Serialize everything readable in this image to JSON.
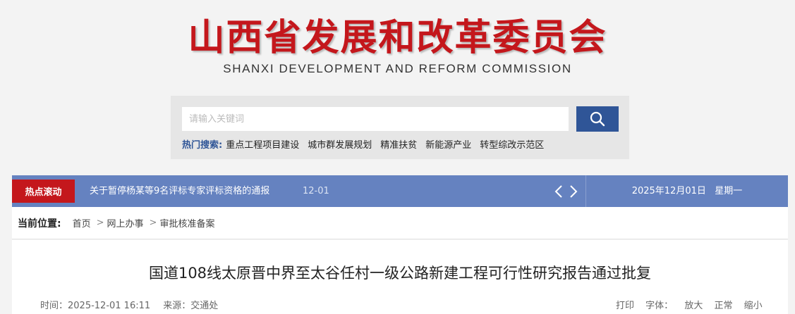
{
  "header": {
    "title": "山西省发展和改革委员会",
    "subtitle": "SHANXI DEVELOPMENT AND REFORM COMMISSION"
  },
  "search": {
    "placeholder": "请输入关键词",
    "button_icon": "search-icon",
    "hot_label": "热门搜索:",
    "hot_terms": [
      "重点工程项目建设",
      "城市群发展规划",
      "精准扶贫",
      "新能源产业",
      "转型综改示范区"
    ]
  },
  "news_bar": {
    "tag": "热点滚动",
    "headline": "关于暂停杨某等9名评标专家评标资格的通报",
    "headline_date": "12-01",
    "today": "2025年12月01日   星期一"
  },
  "breadcrumb": {
    "label": "当前位置:",
    "items": [
      "首页",
      "网上办事",
      "审批核准备案"
    ],
    "separator": ">"
  },
  "article": {
    "title": "国道108线太原晋中界至太谷任村一级公路新建工程可行性研究报告通过批复",
    "time": "时间：2025-12-01 16:11",
    "source": "来源：交通处",
    "print": "打印",
    "font_label": "字体：",
    "font_large": "放大",
    "font_normal": "正常",
    "font_small": "缩小"
  },
  "colors": {
    "brand_red": "#c4171c",
    "bar_blue": "#6582c0",
    "button_blue": "#2f5597"
  }
}
